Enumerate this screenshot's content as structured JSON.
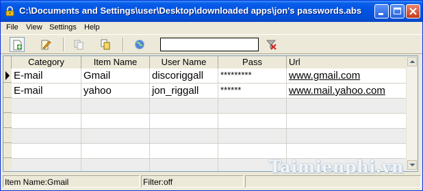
{
  "window": {
    "title": "C:\\Documents and Settings\\user\\Desktop\\downloaded apps\\jon's passwords.abs",
    "icon": "lock-icon"
  },
  "menu": [
    "File",
    "View",
    "Settings",
    "Help"
  ],
  "toolbar": {
    "icons": [
      "add-record-icon",
      "edit-record-icon",
      "copy-icon",
      "paste-icon",
      "web-globe-icon",
      "clear-filter-icon"
    ],
    "search_value": ""
  },
  "table": {
    "columns": [
      "Category",
      "Item Name",
      "User Name",
      "Pass",
      "Url"
    ],
    "rows": [
      {
        "category": "E-mail",
        "item_name": "Gmail",
        "user_name": "discoriggall",
        "pass": "*********",
        "url": "www.gmail.com",
        "selected": true
      },
      {
        "category": "E-mail",
        "item_name": "yahoo",
        "user_name": "jon_riggall",
        "pass": "******",
        "url": "www.mail.yahoo.com",
        "selected": false
      }
    ]
  },
  "status": {
    "item_name": "Item Name:Gmail",
    "filter": "Filter:off"
  },
  "watermark": "Taimienphi.vn",
  "colors": {
    "titlebar": "#0054e3",
    "chrome": "#ece9d8",
    "empty_row": "#ededed"
  }
}
